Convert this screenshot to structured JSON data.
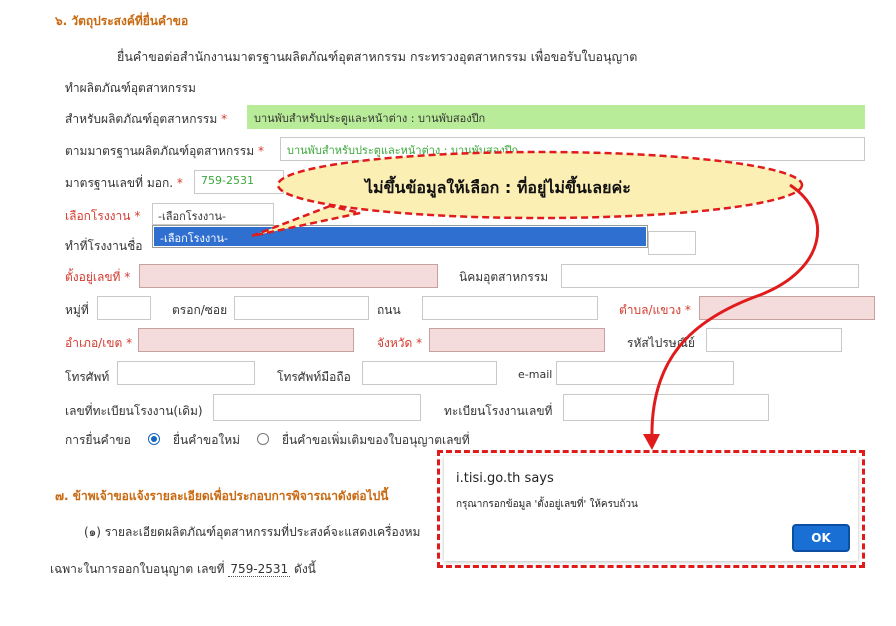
{
  "section6": {
    "title": "๖. วัตถุประสงค์ที่ยื่นคำขอ",
    "intro": "ยื่นคำขอต่อสำนักงานมาตรฐานผลิตภัณฑ์อุตสาหกรรม กระทรวงอุตสาหกรรม เพื่อขอรับใบอนุญาต",
    "make_product": "ทำผลิตภัณฑ์อุตสาหกรรม",
    "for_product_label": "สำหรับผลิตภัณฑ์อุตสาหกรรม",
    "for_product_value": "บานพับสำหรับประตูและหน้าต่าง : บานพับสองปีก",
    "standard_label": "ตามมาตรฐานผลิตภัณฑ์อุตสาหกรรม",
    "standard_value": "บานพับสำหรับประตูและหน้าต่าง : บานพับสองปีก",
    "tis_no_label": "มาตรฐานเลขที่ มอก.",
    "tis_no_value": "759-2531",
    "factory_select_label": "เลือกโรงงาน",
    "factory_select_value": "-เลือกโรงงาน-",
    "factory_dropdown_options": [
      "-เลือกโรงงาน-"
    ],
    "made_at_label": "ทำที่โรงงานชื่อ",
    "address_no_label": "ตั้งอยู่เลขที่",
    "estate_label": "นิคมอุตสาหกรรม",
    "moo_label": "หมู่ที่",
    "soi_label": "ตรอก/ซอย",
    "road_label": "ถนน",
    "subdistrict_label": "ตำบล/แขวง",
    "district_label": "อำเภอ/เขต",
    "province_label": "จังหวัด",
    "postcode_label": "รหัสไปรษณีย์",
    "phone_label": "โทรศัพท์",
    "mobile_label": "โทรศัพท์มือถือ",
    "email_label": "e-mail",
    "old_reg_label": "เลขที่ทะเบียนโรงงาน(เดิม)",
    "reg_label": "ทะเบียนโรงงานเลขที่",
    "submission_label": "การยื่นคำขอ",
    "option_new": "ยื่นคำขอใหม่",
    "option_additional": "ยื่นคำขอเพิ่มเติมของใบอนุญาตเลขที่",
    "required_mark": "*"
  },
  "section7": {
    "title": "๗. ข้าพเจ้าขอแจ้งรายละเอียดเพื่อประกอบการพิจารณาดังต่อไปนี้",
    "item1": "(๑) รายละเอียดผลิตภัณฑ์อุตสาหกรรมที่ประสงค์จะแสดงเครื่องหม",
    "license_prefix": "เฉพาะในการออกใบอนุญาต เลขที่",
    "license_no": "759-2531",
    "license_suffix": "ดังนี้"
  },
  "annotation": {
    "callout_text": "ไม่ขึ้นข้อมูลให้เลือก : ที่อยู่ไม่ขึ้นเลยค่ะ",
    "callout_fill": "#fcefb4",
    "outline_color": "#e01b1b"
  },
  "alert": {
    "origin": "i.tisi.go.th says",
    "message": "กรุณากรอกข้อมูล 'ตั้งอยู่เลขที่' ให้ครบถ้วน",
    "ok_label": "OK",
    "ok_color": "#1a6fd4"
  },
  "colors": {
    "section_title": "#c96a12",
    "required_label": "#d43b2f",
    "required_field_bg": "#f5dcdc",
    "prefilled_bg": "#b9ec99",
    "highlight_option": "#2f6fd0"
  }
}
